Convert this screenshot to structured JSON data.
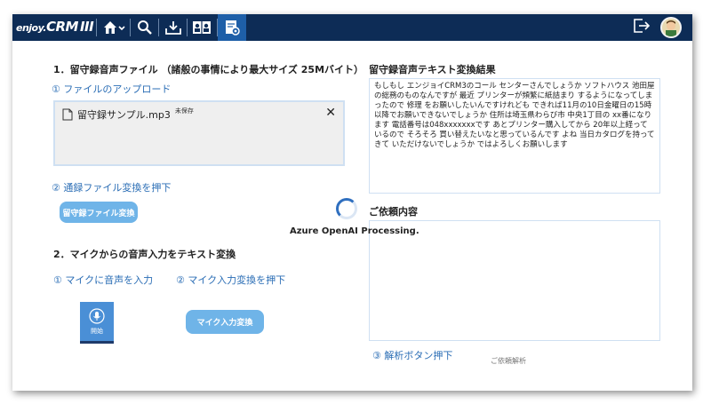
{
  "header": {
    "logo_prefix": "enjoy.",
    "logo_main": "CRM",
    "logo_suffix": "III"
  },
  "section1": {
    "title": "1．留守録音声ファイル （諸般の事情により最大サイズ 25Mバイト）",
    "step1": "① ファイルのアップロード",
    "file_name": "留守録サンプル.mp3",
    "file_status": "未保存",
    "close": "✕",
    "step2": "② 通録ファイル変換を押下",
    "convert_button": "留守録ファイル変換"
  },
  "section2": {
    "title": "2．マイクからの音声入力をテキスト変換",
    "step1": "① マイクに音声を入力",
    "step2": "② マイク入力変換を押下",
    "mic_label": "開始",
    "mic_convert_button": "マイク入力変換"
  },
  "result": {
    "title": "留守録音声テキスト変換結果",
    "text": "もしもし エンジョイCRM3のコール センターさんでしょうか ソフトハウス 池田屋の総務のものなんですが 最近 プリンターが頻繁に紙詰まり するようになってしまったので 修理 をお願いしたいんですけれども できれば11月の10日金曜日の15時 以降でお願いできないでしょうか 住所は埼玉県わらび市 中央1丁目の xx番になります 電話番号は048xxxxxxxです あとプリンター購入してから 20年以上経っているので そろそろ 買い替えたいなと思っているんです よね 当日カタログを持ってきて いただけないでしょうか ではよろしくお願いします"
  },
  "request": {
    "title": "ご依頼内容",
    "text": "",
    "step3": "③ 解析ボタン押下",
    "analyze_button": "ご依頼解析"
  },
  "overlay": {
    "processing_text": "Azure OpenAI Processing."
  },
  "colors": {
    "topbar": "#0d2c56",
    "accent": "#2a6db5",
    "button": "#6fb4e8"
  }
}
